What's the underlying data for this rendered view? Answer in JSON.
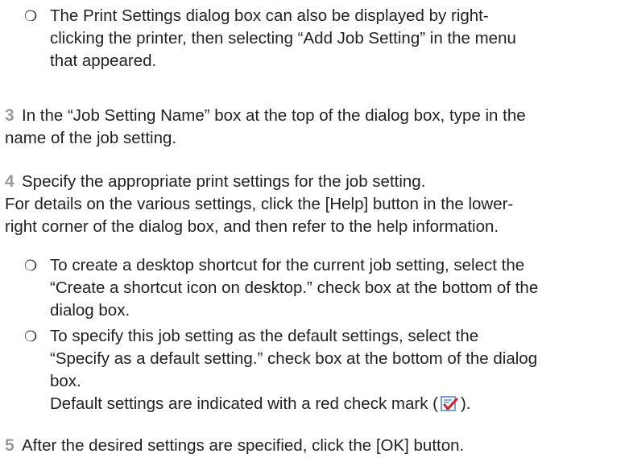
{
  "bullet_top": {
    "mark": "❍",
    "lines": [
      "The Print Settings dialog box can also be displayed by right-",
      "clicking the printer, then selecting “Add Job Setting” in the menu",
      "that appeared."
    ]
  },
  "step3": {
    "number": "3",
    "lines": [
      "In the “Job Setting Name” box at the top of the dialog box, type in the",
      "name of the job setting."
    ]
  },
  "step4": {
    "number": "4",
    "lines": [
      "Specify the appropriate print settings for the job setting.",
      "For details on the various settings, click the [Help] button in the lower-",
      "right corner of the dialog box, and then refer to the help information."
    ]
  },
  "bullet_shortcut": {
    "mark": "❍",
    "lines": [
      "To create a desktop shortcut for the current job setting, select the",
      "“Create a shortcut icon on desktop.” check box at the bottom of the",
      "dialog box."
    ]
  },
  "bullet_default": {
    "mark": "❍",
    "lines": [
      "To specify this job setting as the default settings, select the",
      "“Specify as a default setting.” check box at the bottom of the dialog",
      "box."
    ],
    "note_before": "Default settings are indicated with a red check mark (",
    "note_after": ").",
    "icon_name": "red-check-mark-icon"
  },
  "step5": {
    "number": "5",
    "text": "After the desired settings are specified, click the [OK] button."
  },
  "colors": {
    "text": "#222222",
    "step_number": "#9a9a9a",
    "check_red": "#d0202a",
    "icon_frame": "#5a8bc8"
  }
}
